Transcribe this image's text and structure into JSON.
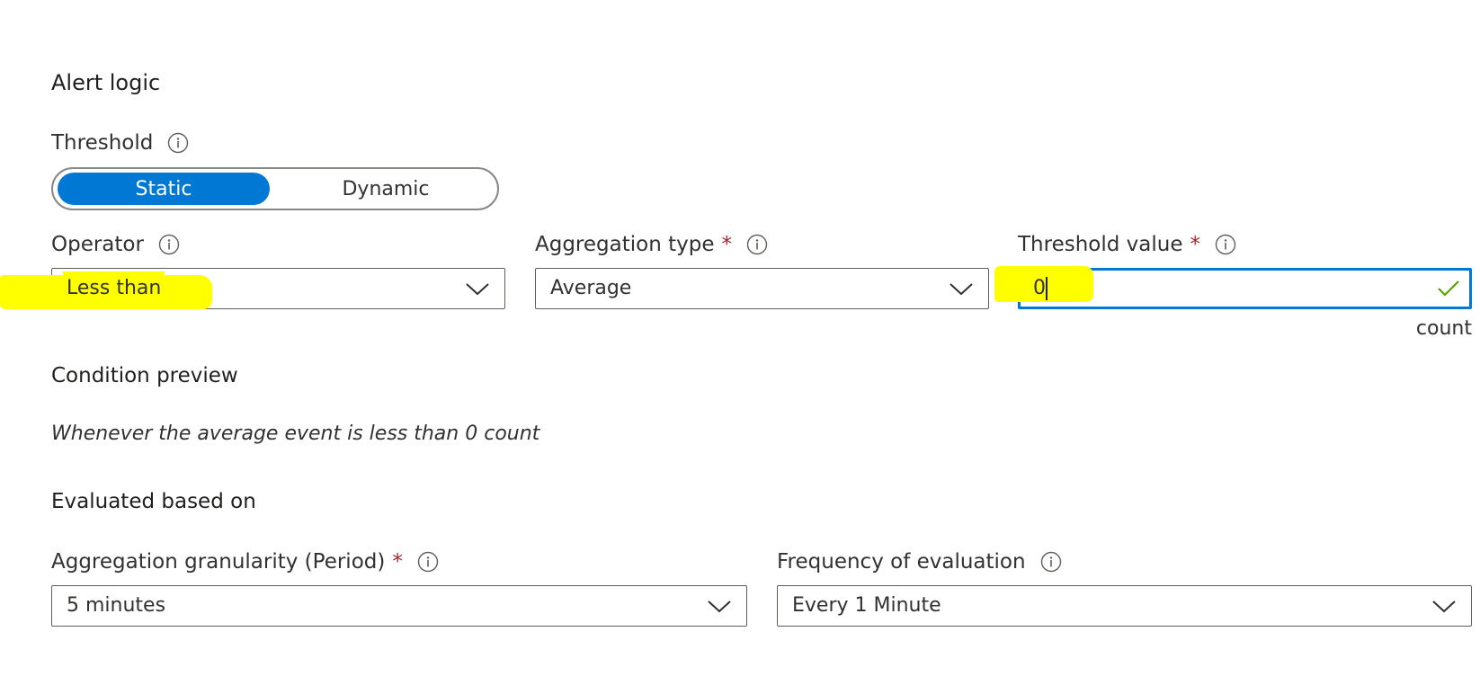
{
  "alert_logic": {
    "title": "Alert logic"
  },
  "threshold": {
    "label": "Threshold",
    "options": [
      "Static",
      "Dynamic"
    ],
    "selected": "Static"
  },
  "operator": {
    "label": "Operator",
    "value": "Less than"
  },
  "aggregation_type": {
    "label": "Aggregation type",
    "required_mark": "*",
    "value": "Average"
  },
  "threshold_value": {
    "label": "Threshold value",
    "required_mark": "*",
    "value": "0",
    "unit": "count"
  },
  "condition_preview": {
    "title": "Condition preview",
    "text": "Whenever the average event is less than 0 count"
  },
  "evaluated": {
    "title": "Evaluated based on"
  },
  "granularity": {
    "label": "Aggregation granularity (Period)",
    "required_mark": "*",
    "value": "5 minutes"
  },
  "frequency": {
    "label": "Frequency of evaluation",
    "value": "Every 1 Minute"
  },
  "icons": {
    "info": "info-icon",
    "chevron": "chevron-down-icon",
    "valid": "checkmark-icon"
  },
  "colors": {
    "accent": "#0078d4",
    "required": "#a4262c",
    "valid": "#57a300",
    "highlight": "#ffff00"
  }
}
